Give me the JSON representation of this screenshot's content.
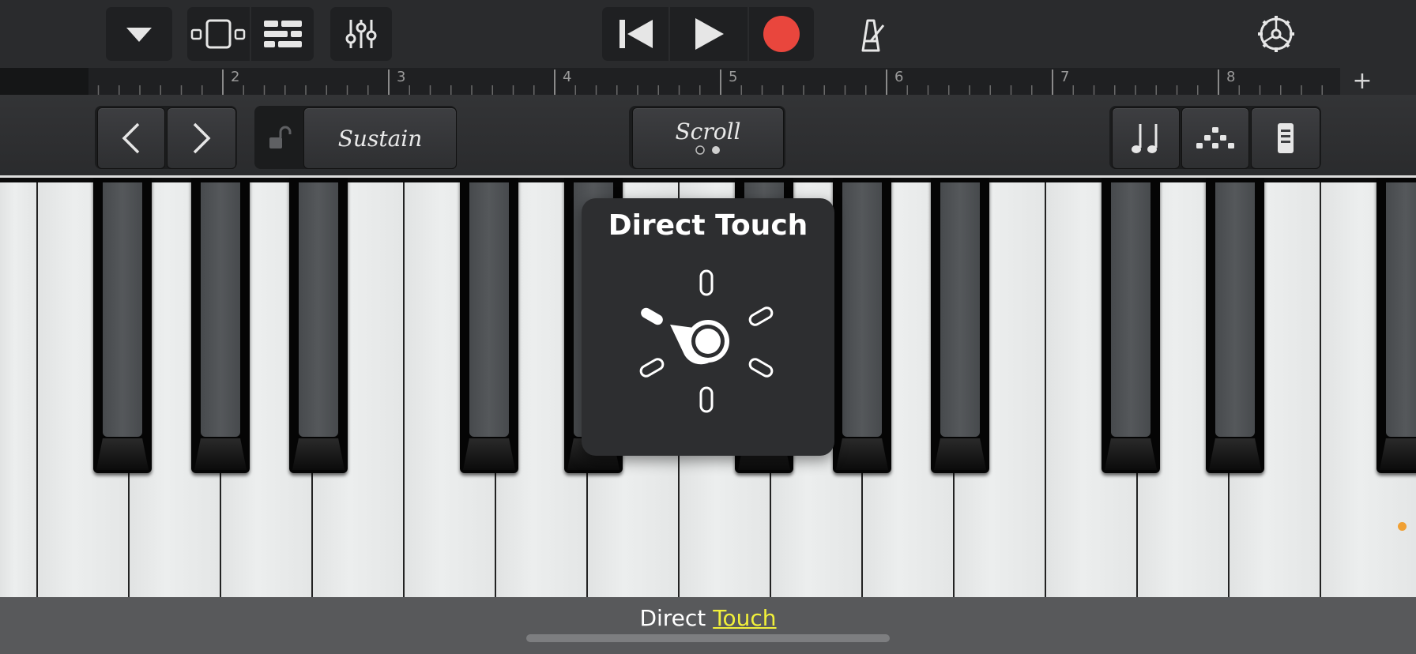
{
  "toolbar": {
    "icons": [
      "dropdown-triangle",
      "tracks-view",
      "editor-grid",
      "mixer-sliders",
      "go-to-start",
      "play",
      "record",
      "metronome",
      "settings-gear"
    ],
    "record_color": "#e9463d"
  },
  "ruler": {
    "bar_numbers": [
      "2",
      "3",
      "4",
      "5",
      "6",
      "7",
      "8"
    ],
    "add_label": "+"
  },
  "controls": {
    "sustain_label": "Sustain",
    "scroll_label": "Scroll",
    "icons": [
      "chevron-left",
      "chevron-right",
      "unlock",
      "notes",
      "arpeggiator",
      "keyboard-controls"
    ]
  },
  "popup": {
    "title": "Direct Touch",
    "icon": "knob-rotary"
  },
  "caption": {
    "word1": "Direct",
    "word2": "Touch",
    "highlight_color": "#f1f03a"
  },
  "accent": {
    "indicator_dot": "#f0a033"
  }
}
